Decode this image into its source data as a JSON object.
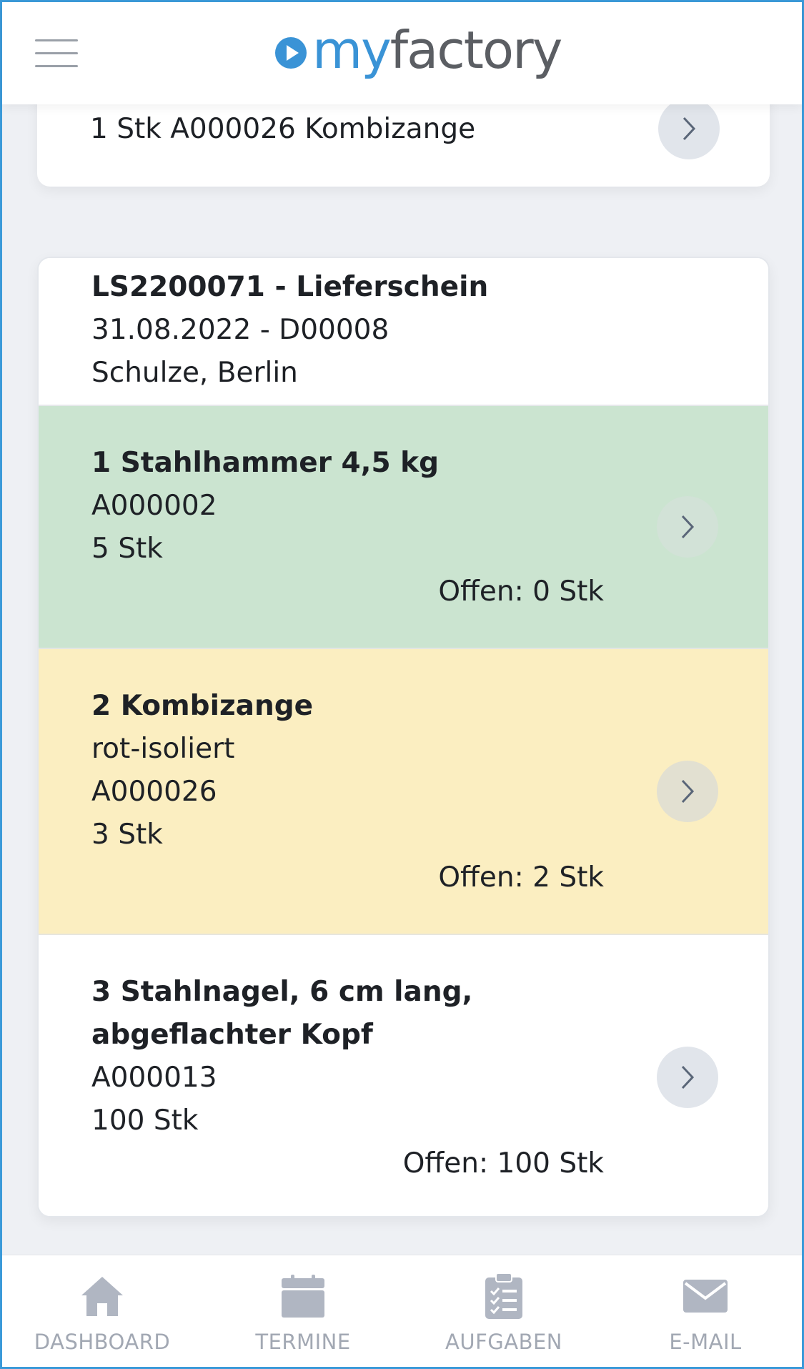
{
  "header": {
    "logo_my": "my",
    "logo_factory": "factory"
  },
  "top_card": {
    "text": "1 Stk A000026 Kombizange"
  },
  "document": {
    "title": "LS2200071 - Lieferschein",
    "date_line": "31.08.2022 - D00008",
    "customer": "Schulze, Berlin",
    "items": [
      {
        "name": "1 Stahlhammer 4,5 kg",
        "article": "A000002",
        "quantity": "5 Stk",
        "open": "Offen: 0 Stk",
        "status_color": "#cbe4d0"
      },
      {
        "name": "2 Kombizange",
        "variant": "rot-isoliert",
        "article": "A000026",
        "quantity": "3 Stk",
        "open": "Offen: 2 Stk",
        "status_color": "#fbeec1"
      },
      {
        "name_line1": "3 Stahlnagel, 6 cm lang,",
        "name_line2": "abgeflachter Kopf",
        "article": "A000013",
        "quantity": "100 Stk",
        "open": "Offen: 100 Stk",
        "status_color": "#ffffff"
      }
    ]
  },
  "bottom_nav": [
    {
      "label": "DASHBOARD",
      "icon": "home-icon"
    },
    {
      "label": "TERMINE",
      "icon": "calendar-icon"
    },
    {
      "label": "AUFGABEN",
      "icon": "clipboard-icon"
    },
    {
      "label": "E-MAIL",
      "icon": "mail-icon"
    }
  ],
  "colors": {
    "accent": "#3a93d6",
    "nav_icon": "#b0b6c2"
  }
}
